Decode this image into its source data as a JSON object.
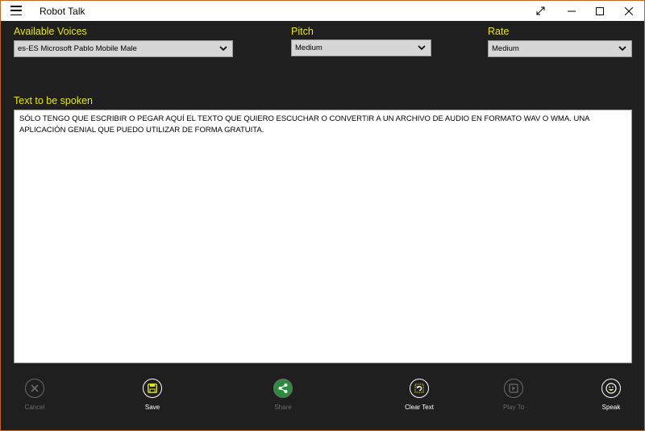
{
  "window": {
    "title": "Robot Talk"
  },
  "voices": {
    "label": "Available Voices",
    "selected": "es-ES Microsoft Pablo Mobile Male"
  },
  "pitch": {
    "label": "Pitch",
    "selected": "Medium"
  },
  "rate": {
    "label": "Rate",
    "selected": "Medium"
  },
  "text_area": {
    "label": "Text to be spoken",
    "value": "Sólo tengo que escribir o pegar aquí el texto que quiero escuchar o convertir a un archivo de audio en formato WAV o WMA. Una aplicación genial que puedo utilizar de forma gratuita."
  },
  "app_bar": {
    "cancel": "Cancel",
    "save": "Save",
    "share": "Share",
    "clear_text": "Clear Text",
    "play_to": "Play To",
    "speak": "Speak"
  },
  "colors": {
    "accent_label": "#e6e61a",
    "background": "#1f1f1f",
    "share_icon_bg": "#2e8b3e",
    "save_icon": "#e6e61a"
  }
}
